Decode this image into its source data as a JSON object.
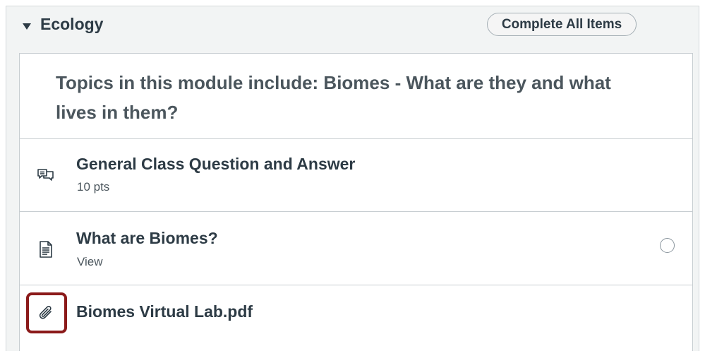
{
  "module": {
    "title": "Ecology",
    "complete_button_label": "Complete All Items",
    "toggle_icon": "caret-down-icon",
    "intro_text": "Topics in this module include: Biomes - What are they and what lives in them?"
  },
  "items": [
    {
      "icon": "discussion-icon",
      "title": "General Class Question and Answer",
      "subtitle": "10 pts"
    },
    {
      "icon": "document-icon",
      "title": "What are Biomes?",
      "subtitle": "View",
      "status": "incomplete"
    },
    {
      "icon": "paperclip-icon",
      "title": "Biomes Virtual Lab.pdf"
    }
  ],
  "colors": {
    "header_bg": "#f2f4f4",
    "text_primary": "#2d3b45",
    "text_secondary": "#4b565d",
    "highlight": "#8b1a1a"
  }
}
